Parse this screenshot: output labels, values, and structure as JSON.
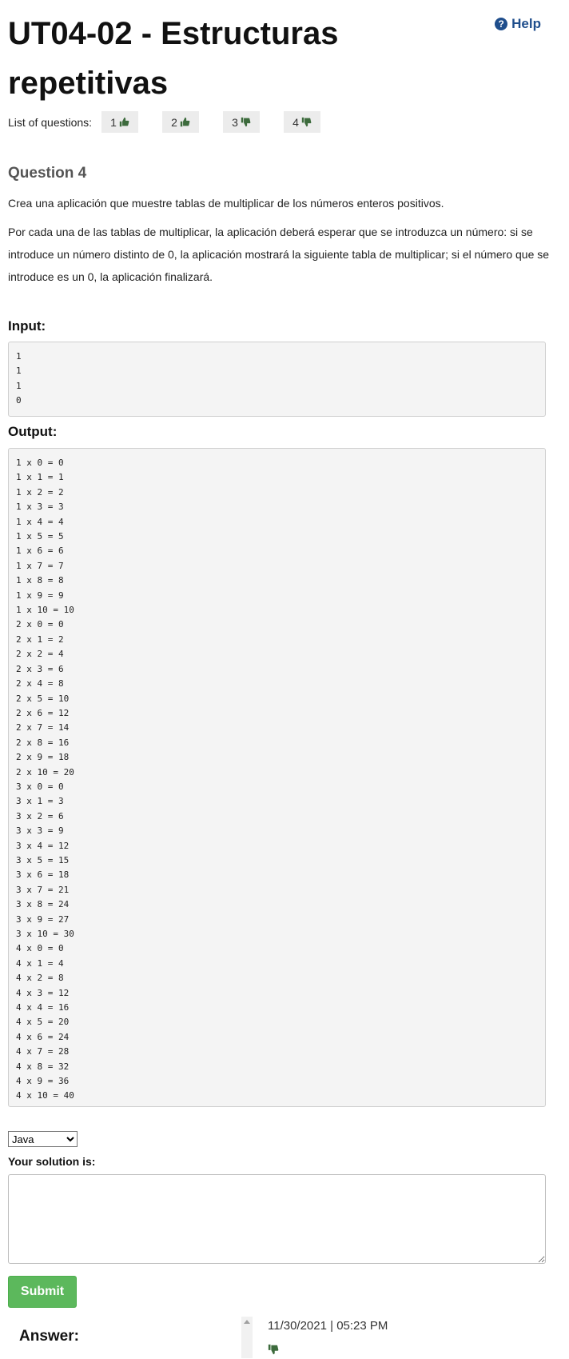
{
  "header": {
    "title": "UT04-02 - Estructuras repetitivas",
    "help_label": "Help"
  },
  "questions": {
    "label": "List of questions:",
    "items": [
      {
        "number": "1",
        "status": "thumbs-up-icon"
      },
      {
        "number": "2",
        "status": "thumbs-up-icon"
      },
      {
        "number": "3",
        "status": "thumbs-down-icon"
      },
      {
        "number": "4",
        "status": "thumbs-down-icon"
      }
    ]
  },
  "question": {
    "title": "Question 4",
    "paragraphs": [
      "Crea una aplicación que muestre tablas de multiplicar de los números enteros positivos.",
      "Por cada una de las tablas de multiplicar, la aplicación deberá esperar que se introduzca un número: si se introduce un número distinto de 0, la aplicación mostrará la siguiente tabla de multiplicar; si el número que se introduce es un 0, la aplicación finalizará."
    ]
  },
  "input": {
    "label": "Input:",
    "content": "1\n1\n1\n0"
  },
  "output": {
    "label": "Output:",
    "content": "1 x 0 = 0\n1 x 1 = 1\n1 x 2 = 2\n1 x 3 = 3\n1 x 4 = 4\n1 x 5 = 5\n1 x 6 = 6\n1 x 7 = 7\n1 x 8 = 8\n1 x 9 = 9\n1 x 10 = 10\n2 x 0 = 0\n2 x 1 = 2\n2 x 2 = 4\n2 x 3 = 6\n2 x 4 = 8\n2 x 5 = 10\n2 x 6 = 12\n2 x 7 = 14\n2 x 8 = 16\n2 x 9 = 18\n2 x 10 = 20\n3 x 0 = 0\n3 x 1 = 3\n3 x 2 = 6\n3 x 3 = 9\n3 x 4 = 12\n3 x 5 = 15\n3 x 6 = 18\n3 x 7 = 21\n3 x 8 = 24\n3 x 9 = 27\n3 x 10 = 30\n4 x 0 = 0\n4 x 1 = 4\n4 x 2 = 8\n4 x 3 = 12\n4 x 4 = 16\n4 x 5 = 20\n4 x 6 = 24\n4 x 7 = 28\n4 x 8 = 32\n4 x 9 = 36\n4 x 10 = 40"
  },
  "solution": {
    "language_selected": "Java",
    "label": "Your solution is:",
    "value": "",
    "submit_label": "Submit"
  },
  "answer": {
    "label": "Answer:",
    "date": "11/30/2021 | 05:23 PM",
    "status_icon": "thumbs-down-icon"
  },
  "colors": {
    "thumb_green": "#3d6b3d",
    "help_blue": "#1f4e8c",
    "submit_green": "#5cb85c"
  }
}
